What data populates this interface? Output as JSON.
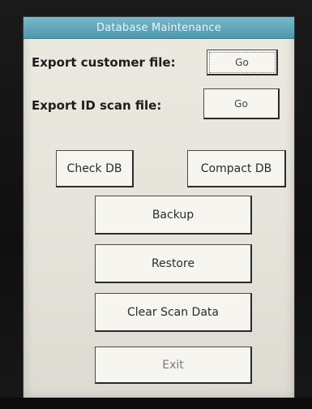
{
  "window": {
    "title": "Database Maintenance"
  },
  "export": {
    "customer_label": "Export customer file:",
    "customer_button": "Go",
    "id_scan_label": "Export ID scan file:",
    "id_scan_button": "Go"
  },
  "actions": {
    "check_db": "Check DB",
    "compact_db": "Compact DB",
    "backup": "Backup",
    "restore": "Restore",
    "clear_scan_data": "Clear Scan Data",
    "exit": "Exit"
  },
  "colors": {
    "title_bar": "#5aa3b8",
    "screen_bg": "#e8e5dd",
    "button_bg": "#f6f5f0",
    "bezel": "#111111"
  }
}
